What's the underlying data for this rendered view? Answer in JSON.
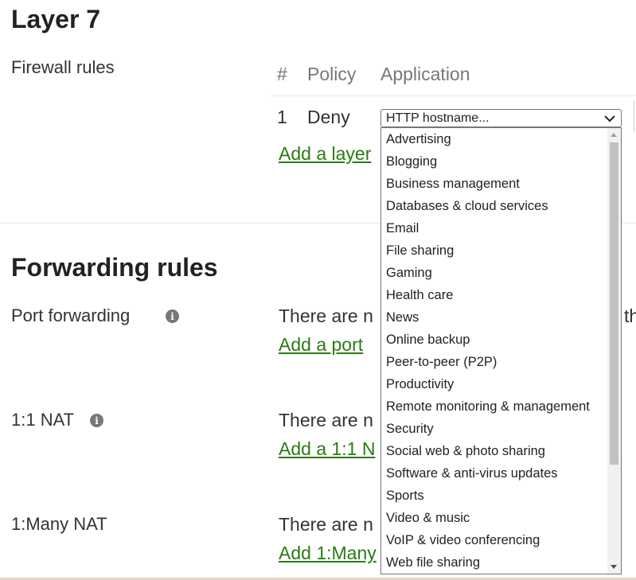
{
  "layer7": {
    "title": "Layer 7",
    "firewall_label": "Firewall rules",
    "columns": [
      "#",
      "Policy",
      "Application"
    ],
    "rule": {
      "number": "1",
      "policy": "Deny",
      "application": "HTTP hostname..."
    },
    "add_link": "Add a layer"
  },
  "forwarding": {
    "title": "Forwarding rules",
    "sections": [
      {
        "label": "Port forwarding",
        "status": "There are n",
        "link": "Add a port",
        "tail": "th"
      },
      {
        "label": "1:1 NAT",
        "status": "There are n",
        "link": "Add a 1:1 N"
      },
      {
        "label": "1:Many NAT",
        "status": "There are n",
        "link": "Add 1:Many"
      }
    ]
  },
  "dropdown": {
    "options": [
      "Advertising",
      "Blogging",
      "Business management",
      "Databases & cloud services",
      "Email",
      "File sharing",
      "Gaming",
      "Health care",
      "News",
      "Online backup",
      "Peer-to-peer (P2P)",
      "Productivity",
      "Remote monitoring & management",
      "Security",
      "Social web & photo sharing",
      "Software & anti-virus updates",
      "Sports",
      "Video & music",
      "VoIP & video conferencing",
      "Web file sharing"
    ]
  },
  "colors": {
    "link": "#2a7a14",
    "muted": "#777777",
    "text": "#222222"
  },
  "icons": {
    "info": "info-icon",
    "chevron": "chevron-down-icon"
  }
}
